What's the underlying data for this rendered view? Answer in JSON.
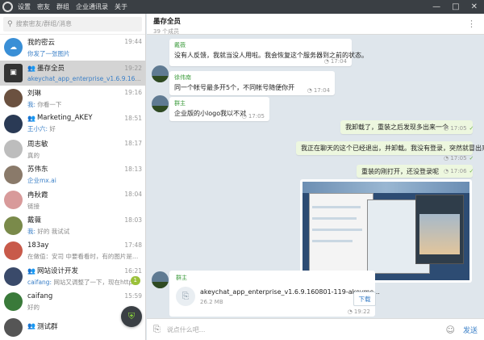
{
  "titlebar": {
    "menu": [
      "设置",
      "密友",
      "群组",
      "企业通讯录",
      "关于"
    ],
    "controls": [
      "—",
      "□",
      "✕"
    ]
  },
  "search": {
    "placeholder": "搜索密友/群组/消息"
  },
  "chats": [
    {
      "name": "我的密云",
      "time": "19:44",
      "msg": "你发了一张图片",
      "msg_color": "#3a7fc7",
      "avatar_color": "#3a8fd6",
      "avatar_icon": "cloud"
    },
    {
      "name": "墨存全员",
      "time": "19:22",
      "msg": "akeychat_app_enterprise_v1.6.9.160801-1...",
      "msg_color": "#3a7fc7",
      "avatar_color": "#333333",
      "avatar_icon": "square",
      "group": true,
      "active": true
    },
    {
      "name": "刘琳",
      "time": "19:16",
      "who": "我:",
      "msg": " 你看一下",
      "avatar_color": "#6b5140"
    },
    {
      "name": "Marketing_AKEY",
      "time": "18:51",
      "who": "王小六:",
      "msg": " 好",
      "avatar_color": "#2a3a55",
      "group": true
    },
    {
      "name": "周志敏",
      "time": "18:17",
      "msg": "真的",
      "avatar_color": "#bdbdbd"
    },
    {
      "name": "苏伟东",
      "time": "18:13",
      "msg": "企业mx.ai",
      "msg_color": "#3a7fc7",
      "avatar_color": "#8a7a6a"
    },
    {
      "name": "冉秋霞",
      "time": "18:04",
      "msg": "链接",
      "avatar_color": "#d89a9a"
    },
    {
      "name": "戴薇",
      "time": "18:03",
      "who": "我:",
      "msg": " 好的 我试试",
      "avatar_color": "#7a8a4a"
    },
    {
      "name": "183ay",
      "time": "17:48",
      "msg": "在做值：安司 中要看看时，有的图片是这样",
      "avatar_color": "#c85a4a"
    },
    {
      "name": "网站设计开发",
      "time": "16:21",
      "who": "caifang:",
      "msg": " 网站又调整了一下，现在http和https",
      "avatar_color": "#3a4a6a",
      "group": true,
      "unread": "1"
    },
    {
      "name": "caifang",
      "time": "15:59",
      "msg": "好的",
      "avatar_color": "#3a7a3a"
    },
    {
      "name": "测试群",
      "time": "",
      "msg": "",
      "avatar_color": "#555555",
      "group": true
    }
  ],
  "chat": {
    "title": "墨存全员",
    "subtitle": "39 个成员",
    "composer_placeholder": "说点什么吧...",
    "send_label": "发送",
    "download_label": "下载",
    "messages": [
      {
        "kind": "in",
        "sender": "戴薇",
        "text": "没有人反馈，我就当没人用啦。我会恢复这个服务器到之前的状态。",
        "time": "17:04"
      },
      {
        "kind": "in",
        "sender": "徐伟南",
        "text": "同一个帐号最多开5个，不同帐号随便你开",
        "time": "17:04"
      },
      {
        "kind": "in",
        "sender": "群主",
        "text": "企业版的小logo我以不对",
        "time": "17:05"
      },
      {
        "kind": "out",
        "text": "我卸载了，重装之后发现多出来一个",
        "time": "17:05"
      },
      {
        "kind": "out",
        "text": "我正在聊天的这个已经退出，并卸载。我没有登录，突然就冒出来了",
        "time": "17:05"
      },
      {
        "kind": "out",
        "text": "重装的刚打开，还没登录呢",
        "time": "17:06"
      },
      {
        "kind": "image"
      },
      {
        "kind": "file",
        "sender": "群主",
        "file_name": "akeychat_app_enterprise_v1.6.9.160801-119-akeyme...",
        "file_size": "26.2 MB",
        "time": "19:22"
      }
    ]
  }
}
